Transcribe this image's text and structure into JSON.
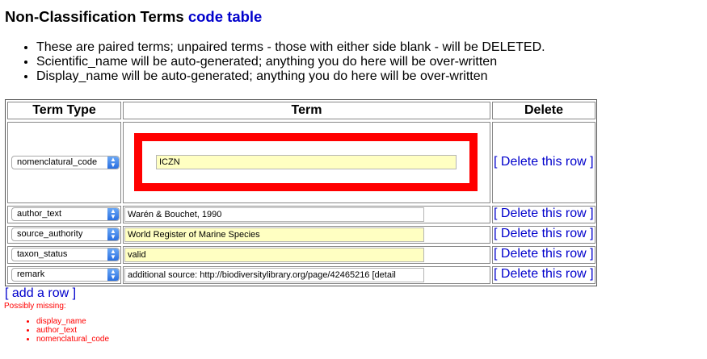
{
  "title": {
    "main": "Non-Classification Terms",
    "link": "code table"
  },
  "notes": [
    "These are paired terms; unpaired terms - those with either side blank - will be DELETED.",
    "Scientific_name will be auto-generated; anything you do here will be over-written",
    "Display_name will be auto-generated; anything you do here will be over-written"
  ],
  "table": {
    "headers": {
      "type": "Term Type",
      "term": "Term",
      "delete": "Delete"
    },
    "rows": [
      {
        "type": "nomenclatural_code",
        "term": "ICZN",
        "delete": "[ Delete this row ]"
      },
      {
        "type": "author_text",
        "term": "Warén & Bouchet, 1990",
        "delete": "[ Delete this row ]"
      },
      {
        "type": "source_authority",
        "term": "World Register of Marine Species",
        "delete": "[ Delete this row ]"
      },
      {
        "type": "taxon_status",
        "term": "valid",
        "delete": "[ Delete this row ]"
      },
      {
        "type": "remark",
        "term": "additional source: http://biodiversitylibrary.org/page/42465216 [detail",
        "delete": "[ Delete this row ]"
      }
    ]
  },
  "add_row": "[ add a row ]",
  "missing": {
    "title": "Possibly missing:",
    "items": [
      "display_name",
      "author_text",
      "nomenclatural_code"
    ]
  },
  "colors": {
    "link": "#0000cc",
    "highlight": "#ff0000",
    "required_field": "#ffffc2"
  }
}
